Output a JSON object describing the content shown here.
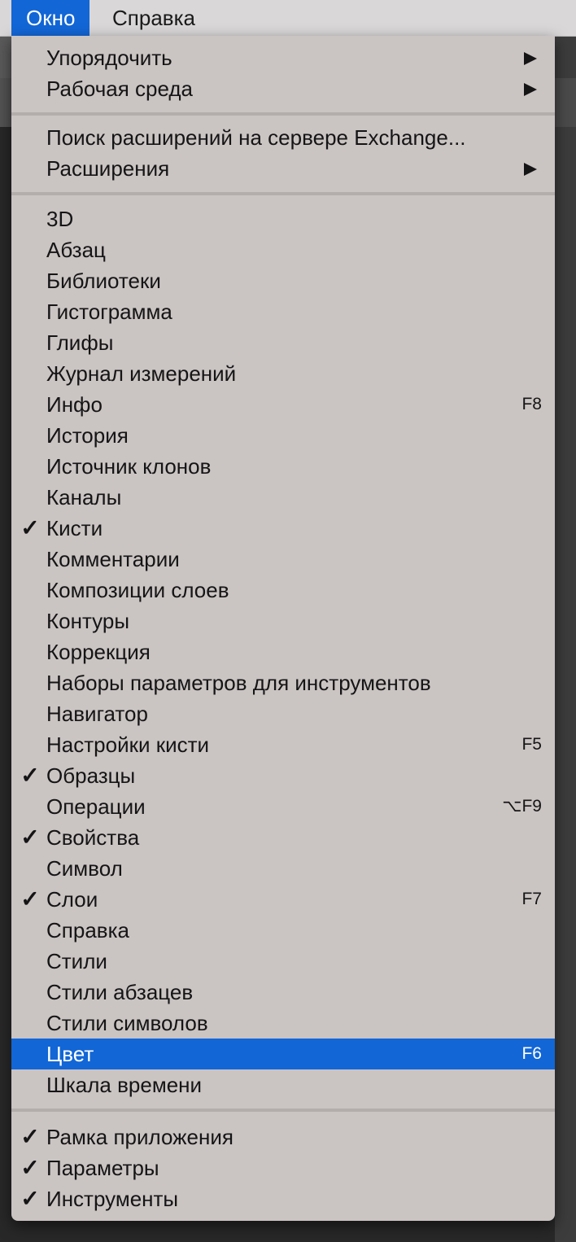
{
  "menubar": {
    "items": [
      {
        "label": "Окно",
        "active": true
      },
      {
        "label": "Справка",
        "active": false
      }
    ]
  },
  "menu": {
    "section1": [
      {
        "label": "Упорядочить",
        "submenu": true
      },
      {
        "label": "Рабочая среда",
        "submenu": true
      }
    ],
    "section2": [
      {
        "label": "Поиск расширений на сервере Exchange...",
        "submenu": false
      },
      {
        "label": "Расширения",
        "submenu": true
      }
    ],
    "section3": [
      {
        "label": "3D",
        "checked": false,
        "shortcut": ""
      },
      {
        "label": "Абзац",
        "checked": false,
        "shortcut": ""
      },
      {
        "label": "Библиотеки",
        "checked": false,
        "shortcut": ""
      },
      {
        "label": "Гистограмма",
        "checked": false,
        "shortcut": ""
      },
      {
        "label": "Глифы",
        "checked": false,
        "shortcut": ""
      },
      {
        "label": "Журнал измерений",
        "checked": false,
        "shortcut": ""
      },
      {
        "label": "Инфо",
        "checked": false,
        "shortcut": "F8"
      },
      {
        "label": "История",
        "checked": false,
        "shortcut": ""
      },
      {
        "label": "Источник клонов",
        "checked": false,
        "shortcut": ""
      },
      {
        "label": "Каналы",
        "checked": false,
        "shortcut": ""
      },
      {
        "label": "Кисти",
        "checked": true,
        "shortcut": ""
      },
      {
        "label": "Комментарии",
        "checked": false,
        "shortcut": ""
      },
      {
        "label": "Композиции слоев",
        "checked": false,
        "shortcut": ""
      },
      {
        "label": "Контуры",
        "checked": false,
        "shortcut": ""
      },
      {
        "label": "Коррекция",
        "checked": false,
        "shortcut": ""
      },
      {
        "label": "Наборы параметров для инструментов",
        "checked": false,
        "shortcut": ""
      },
      {
        "label": "Навигатор",
        "checked": false,
        "shortcut": ""
      },
      {
        "label": "Настройки кисти",
        "checked": false,
        "shortcut": "F5"
      },
      {
        "label": "Образцы",
        "checked": true,
        "shortcut": ""
      },
      {
        "label": "Операции",
        "checked": false,
        "shortcut": "⌥F9"
      },
      {
        "label": "Свойства",
        "checked": true,
        "shortcut": ""
      },
      {
        "label": "Символ",
        "checked": false,
        "shortcut": ""
      },
      {
        "label": "Слои",
        "checked": true,
        "shortcut": "F7"
      },
      {
        "label": "Справка",
        "checked": false,
        "shortcut": ""
      },
      {
        "label": "Стили",
        "checked": false,
        "shortcut": ""
      },
      {
        "label": "Стили абзацев",
        "checked": false,
        "shortcut": ""
      },
      {
        "label": "Стили символов",
        "checked": false,
        "shortcut": ""
      },
      {
        "label": "Цвет",
        "checked": false,
        "shortcut": "F6",
        "highlighted": true
      },
      {
        "label": "Шкала времени",
        "checked": false,
        "shortcut": ""
      }
    ],
    "section4": [
      {
        "label": "Рамка приложения",
        "checked": true
      },
      {
        "label": "Параметры",
        "checked": true
      },
      {
        "label": "Инструменты",
        "checked": true
      }
    ],
    "check_glyph": "✓",
    "highlight_color": "#1266d6"
  }
}
